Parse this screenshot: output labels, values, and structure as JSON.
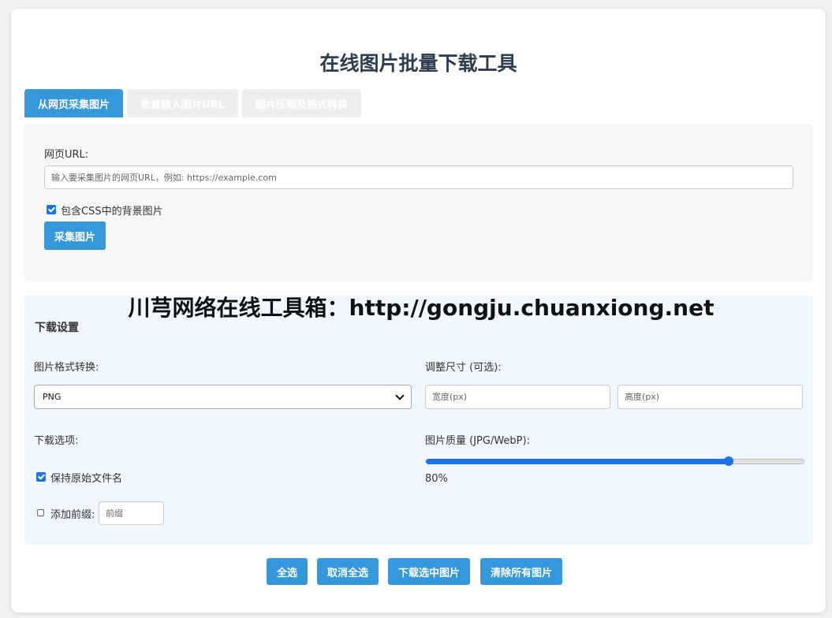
{
  "title": "在线图片批量下载工具",
  "tabs": [
    {
      "label": "从网页采集图片",
      "active": true
    },
    {
      "label": "批量输入图片URL",
      "active": false
    },
    {
      "label": "图片压缩及格式转换",
      "active": false
    }
  ],
  "url_panel": {
    "url_label": "网页URL:",
    "url_placeholder": "输入要采集图片的网页URL，例如: https://example.com",
    "include_css_label": "包含CSS中的背景图片",
    "include_css_checked": true,
    "collect_button": "采集图片"
  },
  "watermark": "川芎网络在线工具箱：http://gongju.chuanxiong.net",
  "download_settings": {
    "section_title": "下载设置",
    "format_label": "图片格式转换:",
    "format_value": "PNG",
    "resize_label": "调整尺寸 (可选):",
    "width_placeholder": "宽度(px)",
    "height_placeholder": "高度(px)",
    "options_label": "下载选项:",
    "keep_name_label": "保持原始文件名",
    "keep_name_checked": true,
    "prefix_label": "添加前缀:",
    "prefix_checked": false,
    "prefix_placeholder": "前缀",
    "quality_label": "图片质量 (JPG/WebP):",
    "quality_value": 80,
    "quality_text": "80%"
  },
  "actions": {
    "select_all": "全选",
    "deselect_all": "取消全选",
    "download_selected": "下载选中图片",
    "clear_all": "清除所有图片"
  },
  "colors": {
    "accent": "#3498db",
    "title": "#2c3e50",
    "checkbox": "#1a73e8"
  }
}
